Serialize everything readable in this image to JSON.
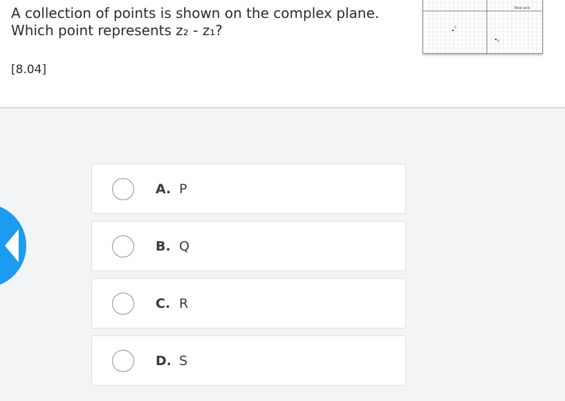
{
  "question": {
    "line1": "A collection of points is shown on the complex plane.",
    "line2": "Which point represents z₂ - z₁?",
    "code": "[8.04]"
  },
  "thumbnail": {
    "axis_label": "Real axis",
    "point_labels": [
      "S",
      "R"
    ]
  },
  "answers": [
    {
      "letter": "A.",
      "text": "P"
    },
    {
      "letter": "B.",
      "text": "Q"
    },
    {
      "letter": "C.",
      "text": "R"
    },
    {
      "letter": "D.",
      "text": "S"
    }
  ],
  "colors": {
    "accent": "#1a9cf0",
    "panel": "#ffffff",
    "background": "#f3f4f6"
  },
  "icons": {
    "back": "back-arrow-icon",
    "radio": "radio-circle-icon"
  }
}
